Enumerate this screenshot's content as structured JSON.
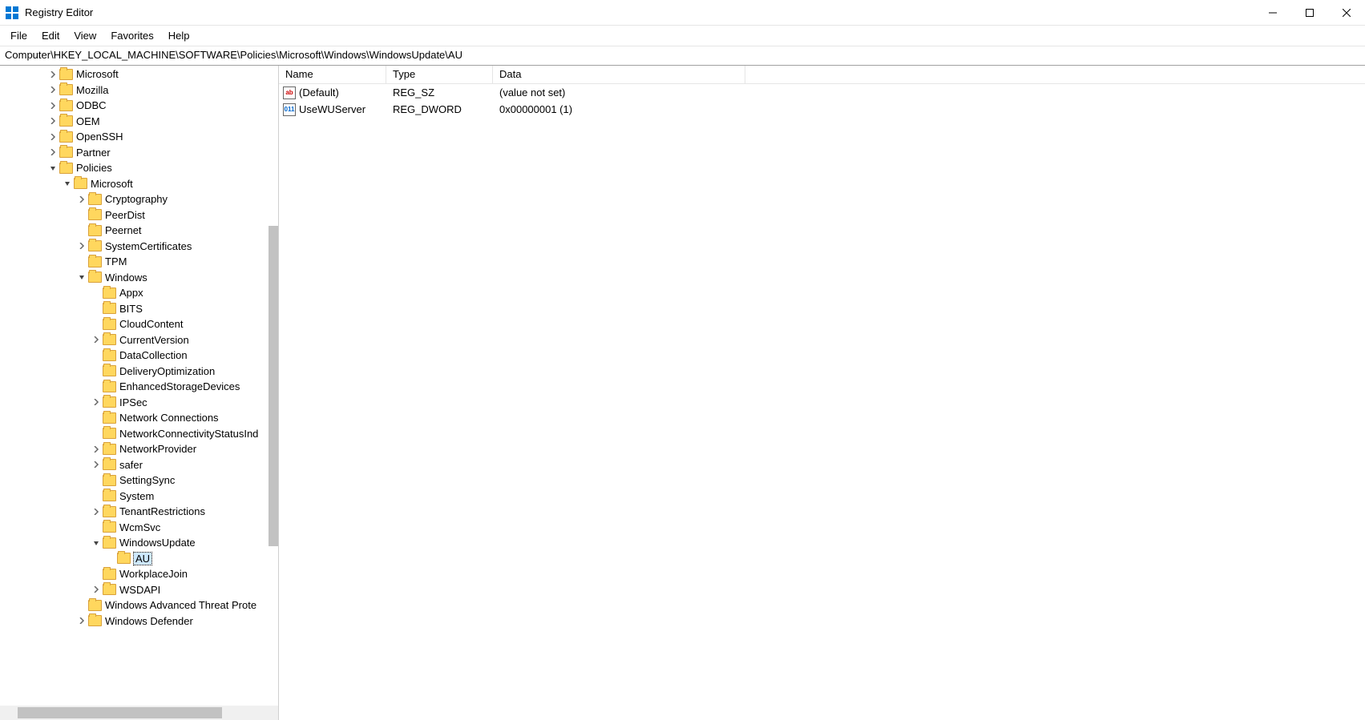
{
  "window": {
    "title": "Registry Editor"
  },
  "menu": {
    "file": "File",
    "edit": "Edit",
    "view": "View",
    "favorites": "Favorites",
    "help": "Help"
  },
  "address": "Computer\\HKEY_LOCAL_MACHINE\\SOFTWARE\\Policies\\Microsoft\\Windows\\WindowsUpdate\\AU",
  "columns": {
    "name": "Name",
    "type": "Type",
    "data": "Data"
  },
  "values": [
    {
      "icon": "sz",
      "name": "(Default)",
      "type": "REG_SZ",
      "data": "(value not set)"
    },
    {
      "icon": "dw",
      "name": "UseWUServer",
      "type": "REG_DWORD",
      "data": "0x00000001 (1)"
    }
  ],
  "tree": [
    {
      "d": 3,
      "e": "c",
      "n": "Microsoft"
    },
    {
      "d": 3,
      "e": "c",
      "n": "Mozilla"
    },
    {
      "d": 3,
      "e": "c",
      "n": "ODBC"
    },
    {
      "d": 3,
      "e": "c",
      "n": "OEM"
    },
    {
      "d": 3,
      "e": "c",
      "n": "OpenSSH"
    },
    {
      "d": 3,
      "e": "c",
      "n": "Partner"
    },
    {
      "d": 3,
      "e": "o",
      "n": "Policies"
    },
    {
      "d": 4,
      "e": "o",
      "n": "Microsoft"
    },
    {
      "d": 5,
      "e": "c",
      "n": "Cryptography"
    },
    {
      "d": 5,
      "e": "",
      "n": "PeerDist"
    },
    {
      "d": 5,
      "e": "",
      "n": "Peernet"
    },
    {
      "d": 5,
      "e": "c",
      "n": "SystemCertificates"
    },
    {
      "d": 5,
      "e": "",
      "n": "TPM"
    },
    {
      "d": 5,
      "e": "o",
      "n": "Windows"
    },
    {
      "d": 6,
      "e": "",
      "n": "Appx"
    },
    {
      "d": 6,
      "e": "",
      "n": "BITS"
    },
    {
      "d": 6,
      "e": "",
      "n": "CloudContent"
    },
    {
      "d": 6,
      "e": "c",
      "n": "CurrentVersion"
    },
    {
      "d": 6,
      "e": "",
      "n": "DataCollection"
    },
    {
      "d": 6,
      "e": "",
      "n": "DeliveryOptimization"
    },
    {
      "d": 6,
      "e": "",
      "n": "EnhancedStorageDevices"
    },
    {
      "d": 6,
      "e": "c",
      "n": "IPSec"
    },
    {
      "d": 6,
      "e": "",
      "n": "Network Connections"
    },
    {
      "d": 6,
      "e": "",
      "n": "NetworkConnectivityStatusInd"
    },
    {
      "d": 6,
      "e": "c",
      "n": "NetworkProvider"
    },
    {
      "d": 6,
      "e": "c",
      "n": "safer"
    },
    {
      "d": 6,
      "e": "",
      "n": "SettingSync"
    },
    {
      "d": 6,
      "e": "",
      "n": "System"
    },
    {
      "d": 6,
      "e": "c",
      "n": "TenantRestrictions"
    },
    {
      "d": 6,
      "e": "",
      "n": "WcmSvc"
    },
    {
      "d": 6,
      "e": "o",
      "n": "WindowsUpdate"
    },
    {
      "d": 7,
      "e": "",
      "n": "AU",
      "sel": true
    },
    {
      "d": 6,
      "e": "",
      "n": "WorkplaceJoin"
    },
    {
      "d": 6,
      "e": "c",
      "n": "WSDAPI"
    },
    {
      "d": 5,
      "e": "",
      "n": "Windows Advanced Threat Prote"
    },
    {
      "d": 5,
      "e": "c",
      "n": "Windows Defender"
    }
  ]
}
